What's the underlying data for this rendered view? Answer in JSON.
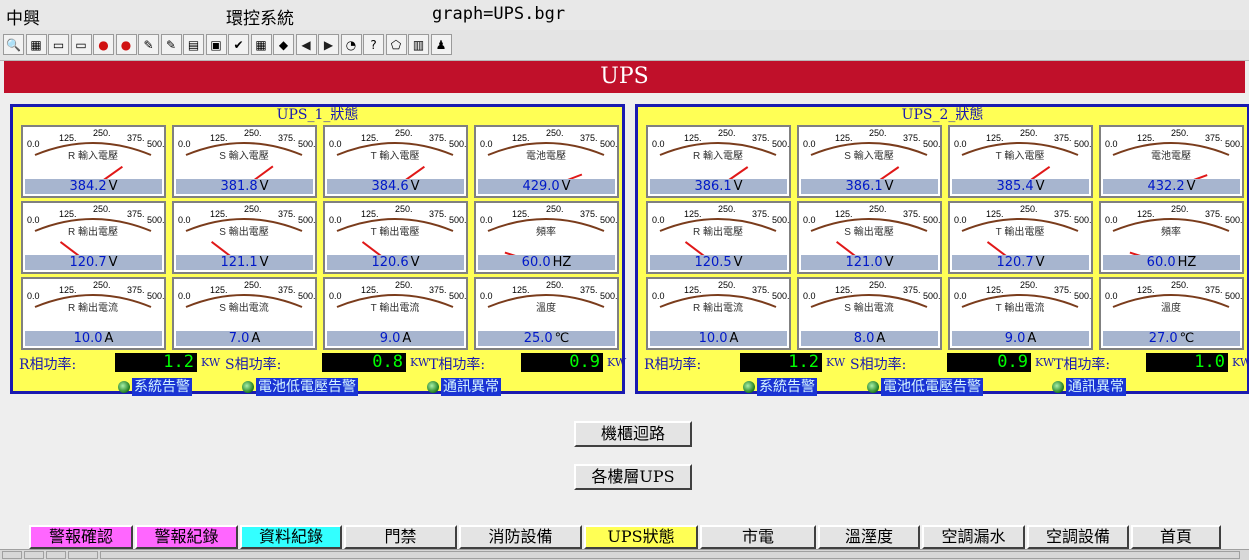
{
  "title_bar": {
    "company": "中興",
    "system": "環控系統",
    "graph": "graph=UPS.bgr"
  },
  "toolbar": {
    "icons": [
      "magnifier-icon",
      "grid-icon",
      "monitor-icon",
      "monitor-alt-icon",
      "red-ball-icon",
      "red-ball-alt-icon",
      "pencil-icon",
      "edit-icon",
      "printer-icon",
      "checklist-icon",
      "checkmark-icon",
      "network-icon",
      "colors-icon",
      "arrow-left-icon",
      "arrow-right-icon",
      "history-icon",
      "help-icon",
      "eraser-icon",
      "calendar-icon",
      "person-icon"
    ]
  },
  "page": {
    "banner": "UPS"
  },
  "gauge_scale": [
    "0.0",
    "125.",
    "250.",
    "375.",
    "500."
  ],
  "panels": [
    {
      "title": "UPS_1_狀態",
      "gauges": [
        {
          "label": "R 輸入電壓",
          "value": "384.2",
          "unit": "V",
          "reading": 384.2
        },
        {
          "label": "S 輸入電壓",
          "value": "381.8",
          "unit": "V",
          "reading": 381.8
        },
        {
          "label": "T 輸入電壓",
          "value": "384.6",
          "unit": "V",
          "reading": 384.6
        },
        {
          "label": "電池電壓",
          "value": "429.0",
          "unit": "V",
          "reading": 429.0
        },
        {
          "label": "R 輸出電壓",
          "value": "120.7",
          "unit": "V",
          "reading": 120.7
        },
        {
          "label": "S 輸出電壓",
          "value": "121.1",
          "unit": "V",
          "reading": 121.1
        },
        {
          "label": "T 輸出電壓",
          "value": "120.6",
          "unit": "V",
          "reading": 120.6
        },
        {
          "label": "頻率",
          "value": "60.0",
          "unit": "HZ",
          "reading": 60.0
        },
        {
          "label": "R 輸出電流",
          "value": "10.0",
          "unit": "A",
          "reading": 10.0
        },
        {
          "label": "S 輸出電流",
          "value": "7.0",
          "unit": "A",
          "reading": 7.0
        },
        {
          "label": "T 輸出電流",
          "value": "9.0",
          "unit": "A",
          "reading": 9.0
        },
        {
          "label": "溫度",
          "value": "25.0",
          "unit": "℃",
          "reading": 25.0
        }
      ],
      "power": [
        {
          "label": "R相功率:",
          "value": "1.2",
          "unit": "KW"
        },
        {
          "label": "S相功率:",
          "value": "0.8",
          "unit": "KW"
        },
        {
          "label": "T相功率:",
          "value": "0.9",
          "unit": "KW"
        }
      ],
      "alarms": [
        "系統告警",
        "電池低電壓告警",
        "通訊異常"
      ]
    },
    {
      "title": "UPS_2_狀態",
      "gauges": [
        {
          "label": "R 輸入電壓",
          "value": "386.1",
          "unit": "V",
          "reading": 386.1
        },
        {
          "label": "S 輸入電壓",
          "value": "386.1",
          "unit": "V",
          "reading": 386.1
        },
        {
          "label": "T 輸入電壓",
          "value": "385.4",
          "unit": "V",
          "reading": 385.4
        },
        {
          "label": "電池電壓",
          "value": "432.2",
          "unit": "V",
          "reading": 432.2
        },
        {
          "label": "R 輸出電壓",
          "value": "120.5",
          "unit": "V",
          "reading": 120.5
        },
        {
          "label": "S 輸出電壓",
          "value": "121.0",
          "unit": "V",
          "reading": 121.0
        },
        {
          "label": "T 輸出電壓",
          "value": "120.7",
          "unit": "V",
          "reading": 120.7
        },
        {
          "label": "頻率",
          "value": "60.0",
          "unit": "HZ",
          "reading": 60.0
        },
        {
          "label": "R 輸出電流",
          "value": "10.0",
          "unit": "A",
          "reading": 10.0
        },
        {
          "label": "S 輸出電流",
          "value": "8.0",
          "unit": "A",
          "reading": 8.0
        },
        {
          "label": "T 輸出電流",
          "value": "9.0",
          "unit": "A",
          "reading": 9.0
        },
        {
          "label": "溫度",
          "value": "27.0",
          "unit": "℃",
          "reading": 27.0
        }
      ],
      "power": [
        {
          "label": "R相功率:",
          "value": "1.2",
          "unit": "KW"
        },
        {
          "label": "S相功率:",
          "value": "0.9",
          "unit": "KW"
        },
        {
          "label": "T相功率:",
          "value": "1.0",
          "unit": "KW"
        }
      ],
      "alarms": [
        "系統告警",
        "電池低電壓告警",
        "通訊異常"
      ]
    }
  ],
  "buttons": {
    "cabinet": "機櫃迴路",
    "floors": "各樓層UPS"
  },
  "nav": [
    {
      "label": "警報確認",
      "color": "#ff66ff"
    },
    {
      "label": "警報紀錄",
      "color": "#ff66ff"
    },
    {
      "label": "資料紀錄",
      "color": "#33ffff"
    },
    {
      "label": "門禁",
      "color": "#e4e4e4"
    },
    {
      "label": "消防設備",
      "color": "#e4e4e4"
    },
    {
      "label": "UPS狀態",
      "color": "#ffff55"
    },
    {
      "label": "市電",
      "color": "#e4e4e4"
    },
    {
      "label": "溫溼度",
      "color": "#e4e4e4"
    },
    {
      "label": "空調漏水",
      "color": "#e4e4e4"
    },
    {
      "label": "空調設備",
      "color": "#e4e4e4"
    },
    {
      "label": "首頁",
      "color": "#e4e4e4"
    }
  ],
  "colors": {
    "banner": "#c0102a",
    "panel_bg": "#ffff55",
    "panel_border": "#1a1ab0",
    "value_text": "#0018c8",
    "power_text": "#00ff00",
    "alarm_bg": "#1a34d4"
  }
}
